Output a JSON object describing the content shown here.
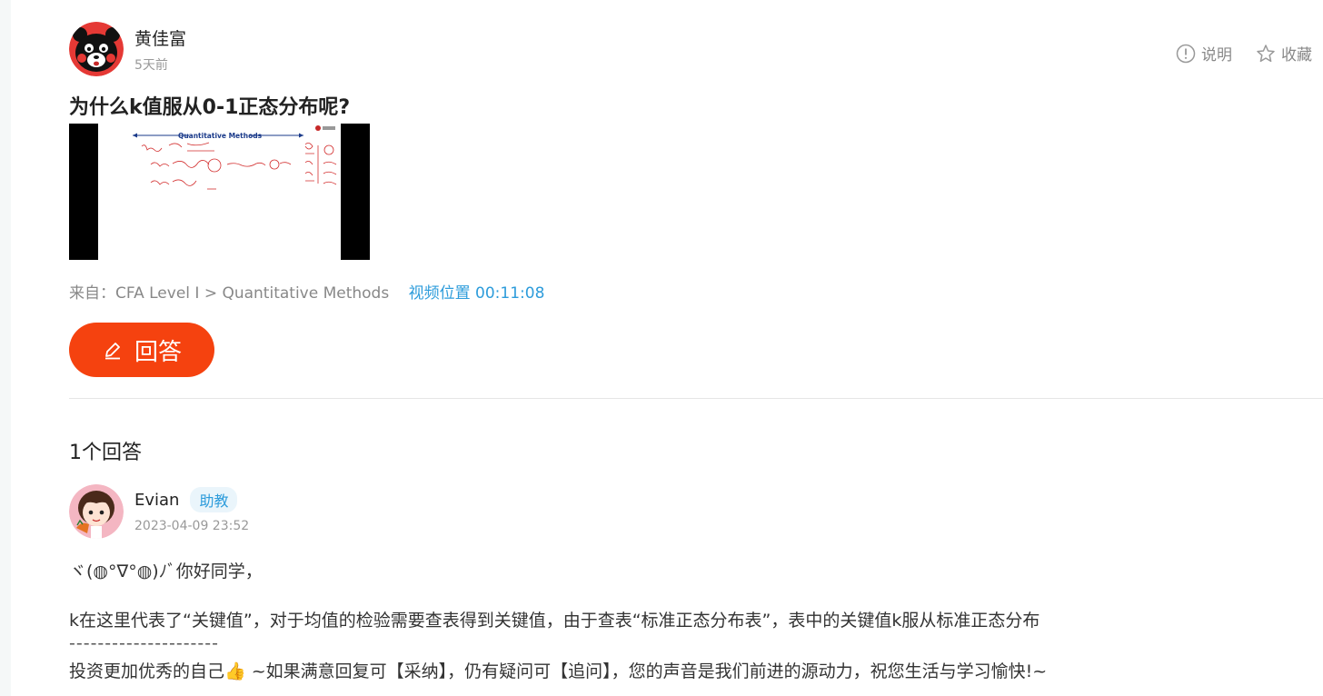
{
  "question": {
    "author": "黄佳富",
    "time": "5天前",
    "title": "为什么k值服从0-1正态分布呢?",
    "thumbnail_heading": "Quantitative Methods",
    "source_label": "来自：CFA Level I > Quantitative Methods",
    "video_position": "视频位置 00:11:08"
  },
  "actions": {
    "explain": "说明",
    "favorite": "收藏"
  },
  "answer_button": "回答",
  "answers_count": "1个回答",
  "answer": {
    "author": "Evian",
    "role": "助教",
    "time": "2023-04-09 23:52",
    "lines": [
      "ヾ(◍°∇°◍)ﾉﾞ你好同学，",
      "k在这里代表了“关键值”，对于均值的检验需要查表得到关键值，由于查表“标准正态分布表”，表中的关键值k服从标准正态分布",
      "---------------------",
      "投资更加优秀的自己👍 ~如果满意回复可【采纳】，仍有疑问可【追问】，您的声音是我们前进的源动力，祝您生活与学习愉快!~"
    ]
  },
  "colors": {
    "accent": "#f5420f",
    "link": "#2d9cdb",
    "badge_bg": "#eaf5fb"
  }
}
